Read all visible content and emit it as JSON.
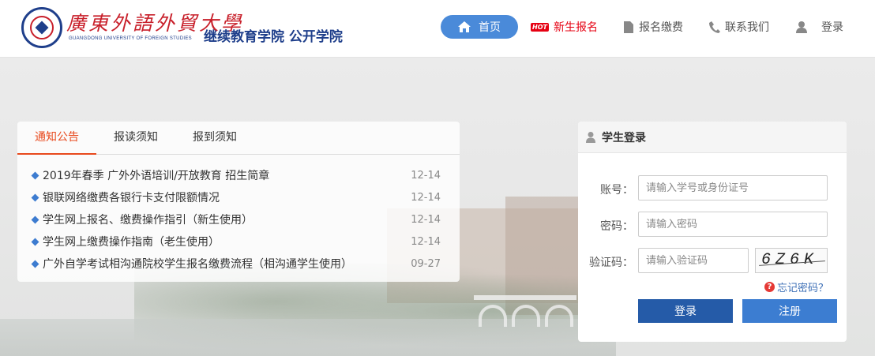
{
  "header": {
    "university_cn": "廣東外語外貿大學",
    "university_en": "GUANGDONG UNIVERSITY OF FOREIGN STUDIES",
    "school_name": "继续教育学院  公开学院",
    "nav": {
      "home": "首页",
      "hot_tag": "HOT",
      "new_enroll": "新生报名",
      "enroll_pay": "报名缴费",
      "contact": "联系我们",
      "login": "登录"
    },
    "colors": {
      "brand_blue": "#1f3f8b",
      "brand_red": "#c8202b",
      "nav_active": "#4a8ad9",
      "hot": "#e60012"
    }
  },
  "notice": {
    "tabs": [
      "通知公告",
      "报读须知",
      "报到须知"
    ],
    "active_tab": "通知公告",
    "items": [
      {
        "title": "2019年春季 广外外语培训/开放教育 招生简章",
        "date": "12-14"
      },
      {
        "title": "银联网络缴费各银行卡支付限额情况",
        "date": "12-14"
      },
      {
        "title": "学生网上报名、缴费操作指引（新生使用）",
        "date": "12-14"
      },
      {
        "title": "学生网上缴费操作指南（老生使用）",
        "date": "12-14"
      },
      {
        "title": "广外自学考试相沟通院校学生报名缴费流程（相沟通学生使用）",
        "date": "09-27"
      }
    ]
  },
  "login": {
    "title": "学生登录",
    "account_label": "账号：",
    "account_placeholder": "请输入学号或身份证号",
    "password_label": "密码：",
    "password_placeholder": "请输入密码",
    "captcha_label": "验证码：",
    "captcha_placeholder": "请输入验证码",
    "captcha_text": "6Z6K",
    "forgot": "忘记密码？",
    "login_button": "登录",
    "register_button": "注册"
  }
}
